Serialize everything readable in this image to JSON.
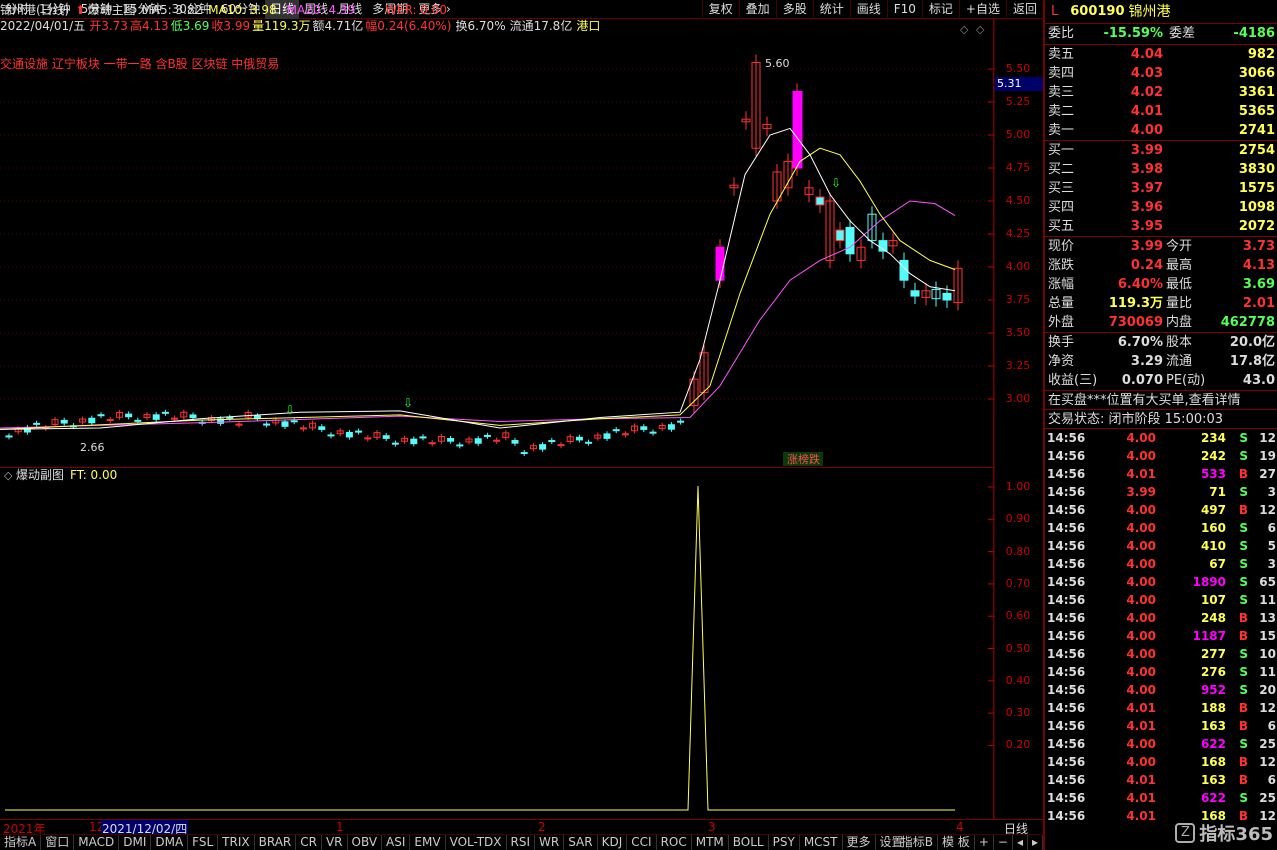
{
  "topbar": {
    "periods": [
      "分时",
      "1分钟",
      "5分钟",
      "15分钟",
      "30分钟",
      "60分钟",
      "日线",
      "周线",
      "月线",
      "多周期",
      "更多 ›"
    ],
    "active_period": "日线",
    "tools": [
      "复权",
      "叠加",
      "多股",
      "统计",
      "画线",
      "F10",
      "标记",
      "+自选",
      "返回"
    ]
  },
  "header": {
    "stock_title": "锦州港(日线)",
    "main_indicator": "爆动主图",
    "ma5": "MA5: 3.82",
    "ma10": "MA10: 3.98",
    "ma20": "MA20: 4.39",
    "wer": "WER: 0.00",
    "date": "2022/04/01/五",
    "open": "开3.73",
    "high": "高4.13",
    "low": "低3.69",
    "close": "收3.99",
    "volume": "量119.3万",
    "amount": "额4.71亿",
    "change": "幅0.24(6.40%)",
    "turnover": "换6.70%",
    "float": "流通17.8亿",
    "port": "港口",
    "concepts": "交通设施 辽宁板块 一带一路 含B股 区块链 中俄贸易"
  },
  "chart_annotations": {
    "high_label": "5.60",
    "low_label": "2.66",
    "limit_label": "涨榜跌"
  },
  "price_axis": {
    "main_ticks": [
      "5.50",
      "5.25",
      "5.00",
      "4.75",
      "4.50",
      "4.25",
      "4.00",
      "3.75",
      "3.50",
      "3.25",
      "3.00"
    ],
    "current": "5.31",
    "sub_ticks": [
      "1.00",
      "0.90",
      "0.80",
      "0.70",
      "0.60",
      "0.50",
      "0.40",
      "0.30",
      "0.20"
    ]
  },
  "sub_header": {
    "title": "爆动副图",
    "ft": "FT: 0.00"
  },
  "date_axis": {
    "labels": [
      "2021年",
      "12",
      "2021/12/02/四",
      "1",
      "2",
      "3",
      "4"
    ],
    "period": "日线"
  },
  "indicator_tabs": [
    "指标A",
    "窗口",
    "MACD",
    "DMI",
    "DMA",
    "FSL",
    "TRIX",
    "BRAR",
    "CR",
    "VR",
    "OBV",
    "ASI",
    "EMV",
    "VOL-TDX",
    "RSI",
    "WR",
    "SAR",
    "KDJ",
    "CCI",
    "ROC",
    "MTM",
    "BOLL",
    "PSY",
    "MCST",
    "更多",
    "设置"
  ],
  "indicator_right": [
    "指标B",
    "模 板"
  ],
  "quote": {
    "flag": "L",
    "code": "600190",
    "name": "锦州港",
    "weibi_label": "委比",
    "weibi": "-15.59%",
    "weicha_label": "委差",
    "weicha": "-4186",
    "asks": [
      {
        "label": "卖五",
        "price": "4.04",
        "vol": "982"
      },
      {
        "label": "卖四",
        "price": "4.03",
        "vol": "3066"
      },
      {
        "label": "卖三",
        "price": "4.02",
        "vol": "3361"
      },
      {
        "label": "卖二",
        "price": "4.01",
        "vol": "5365"
      },
      {
        "label": "卖一",
        "price": "4.00",
        "vol": "2741"
      }
    ],
    "bids": [
      {
        "label": "买一",
        "price": "3.99",
        "vol": "2754"
      },
      {
        "label": "买二",
        "price": "3.98",
        "vol": "3830"
      },
      {
        "label": "买三",
        "price": "3.97",
        "vol": "1575"
      },
      {
        "label": "买四",
        "price": "3.96",
        "vol": "1098"
      },
      {
        "label": "买五",
        "price": "3.95",
        "vol": "2072"
      }
    ],
    "stats": [
      {
        "l1": "现价",
        "v1": "3.99",
        "l2": "今开",
        "v2": "3.73"
      },
      {
        "l1": "涨跌",
        "v1": "0.24",
        "l2": "最高",
        "v2": "4.13"
      },
      {
        "l1": "涨幅",
        "v1": "6.40%",
        "l2": "最低",
        "v2": "3.69"
      },
      {
        "l1": "总量",
        "v1": "119.3万",
        "l2": "量比",
        "v2": "2.01"
      },
      {
        "l1": "外盘",
        "v1": "730069",
        "l2": "内盘",
        "v2": "462778"
      }
    ],
    "stats2": [
      {
        "l1": "换手",
        "v1": "6.70%",
        "l2": "股本",
        "v2": "20.0亿"
      },
      {
        "l1": "净资",
        "v1": "3.29",
        "l2": "流通",
        "v2": "17.8亿"
      },
      {
        "l1": "收益(三)",
        "v1": "0.070",
        "l2": "PE(动)",
        "v2": "43.0"
      }
    ],
    "notice": "在买盘***位置有大买单,查看详情",
    "status": "交易状态: 闭市阶段 15:00:03"
  },
  "ticks": [
    {
      "t": "14:56",
      "p": "4.00",
      "v": "234",
      "d": "S",
      "n": "12"
    },
    {
      "t": "14:56",
      "p": "4.00",
      "v": "242",
      "d": "S",
      "n": "19"
    },
    {
      "t": "14:56",
      "p": "4.01",
      "v": "533",
      "d": "B",
      "n": "27"
    },
    {
      "t": "14:56",
      "p": "3.99",
      "v": "71",
      "d": "S",
      "n": "3"
    },
    {
      "t": "14:56",
      "p": "4.00",
      "v": "497",
      "d": "B",
      "n": "12"
    },
    {
      "t": "14:56",
      "p": "4.00",
      "v": "160",
      "d": "S",
      "n": "6"
    },
    {
      "t": "14:56",
      "p": "4.00",
      "v": "410",
      "d": "S",
      "n": "5"
    },
    {
      "t": "14:56",
      "p": "4.00",
      "v": "67",
      "d": "S",
      "n": "3"
    },
    {
      "t": "14:56",
      "p": "4.00",
      "v": "1890",
      "d": "S",
      "n": "65"
    },
    {
      "t": "14:56",
      "p": "4.00",
      "v": "107",
      "d": "S",
      "n": "11"
    },
    {
      "t": "14:56",
      "p": "4.00",
      "v": "248",
      "d": "B",
      "n": "13"
    },
    {
      "t": "14:56",
      "p": "4.00",
      "v": "1187",
      "d": "B",
      "n": "15"
    },
    {
      "t": "14:56",
      "p": "4.00",
      "v": "277",
      "d": "S",
      "n": "10"
    },
    {
      "t": "14:56",
      "p": "4.00",
      "v": "276",
      "d": "S",
      "n": "11"
    },
    {
      "t": "14:56",
      "p": "4.00",
      "v": "952",
      "d": "S",
      "n": "20"
    },
    {
      "t": "14:56",
      "p": "4.01",
      "v": "188",
      "d": "B",
      "n": "12"
    },
    {
      "t": "14:56",
      "p": "4.01",
      "v": "163",
      "d": "B",
      "n": "6"
    },
    {
      "t": "14:56",
      "p": "4.00",
      "v": "622",
      "d": "S",
      "n": "25"
    },
    {
      "t": "14:56",
      "p": "4.00",
      "v": "168",
      "d": "B",
      "n": "12"
    },
    {
      "t": "14:56",
      "p": "4.01",
      "v": "163",
      "d": "B",
      "n": "6"
    },
    {
      "t": "14:56",
      "p": "4.01",
      "v": "622",
      "d": "S",
      "n": "25"
    },
    {
      "t": "14:56",
      "p": "4.01",
      "v": "168",
      "d": "B",
      "n": "12"
    }
  ],
  "watermark": "指标365",
  "colors": {
    "up": "#ff3232",
    "down": "#54fcfc",
    "ma5": "#ffffff",
    "ma10": "#ffff54",
    "ma20": "#ff54ff",
    "axis": "#c00000",
    "hot": "#ff00ff"
  }
}
